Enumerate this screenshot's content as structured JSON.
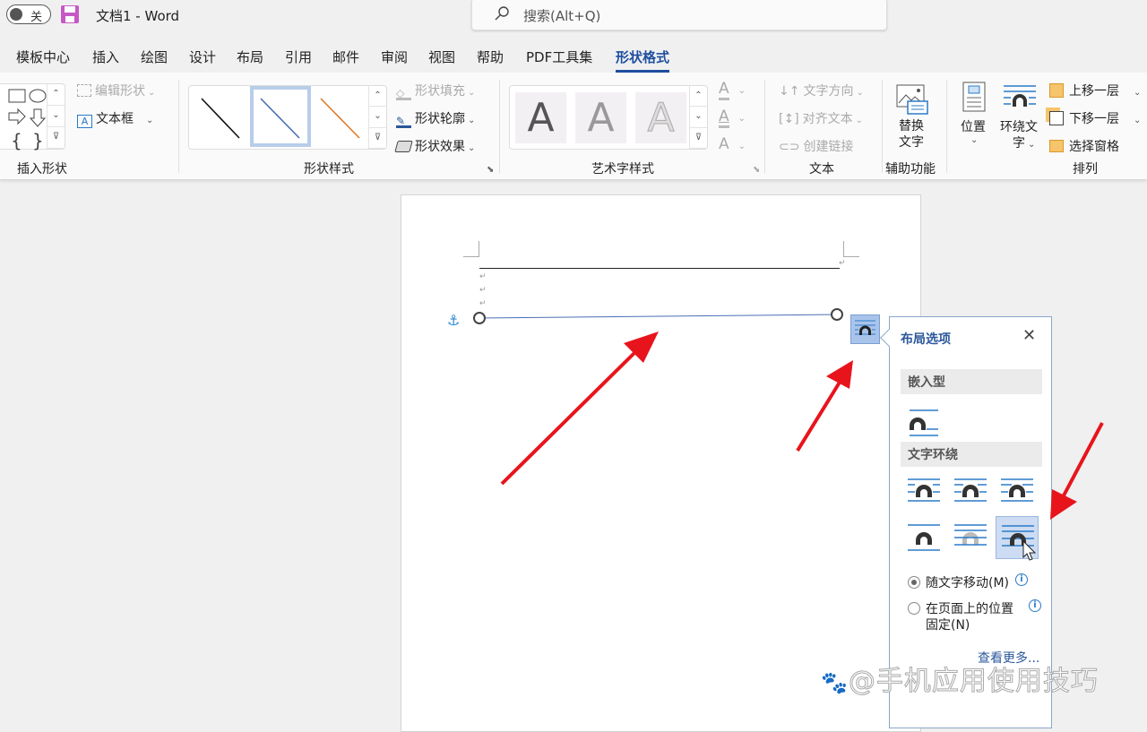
{
  "titlebar": {
    "autosave_label": "关",
    "doc_title": "文档1  -  Word",
    "search_placeholder": "搜索(Alt+Q)"
  },
  "tabs": [
    {
      "label": "模板中心"
    },
    {
      "label": "插入"
    },
    {
      "label": "绘图"
    },
    {
      "label": "设计"
    },
    {
      "label": "布局"
    },
    {
      "label": "引用"
    },
    {
      "label": "邮件"
    },
    {
      "label": "审阅"
    },
    {
      "label": "视图"
    },
    {
      "label": "帮助"
    },
    {
      "label": "PDF工具集"
    },
    {
      "label": "形状格式",
      "active": true
    }
  ],
  "ribbon": {
    "insert_shapes": {
      "label": "插入形状",
      "edit_shape": "编辑形状",
      "text_box": "文本框"
    },
    "shape_styles": {
      "label": "形状样式",
      "styles": [
        {
          "name": "black-line",
          "color": "#111111"
        },
        {
          "name": "blue-line",
          "color": "#4a6fb5",
          "selected": true
        },
        {
          "name": "orange-line",
          "color": "#e07b2a"
        }
      ],
      "fill": "形状填充",
      "outline": "形状轮廓",
      "effects": "形状效果"
    },
    "wordart": {
      "label": "艺术字样式",
      "samples": [
        "A",
        "A",
        "A"
      ]
    },
    "text": {
      "label": "文本",
      "direction": "文字方向",
      "align": "对齐文本",
      "link": "创建链接"
    },
    "accessibility": {
      "label": "辅助功能",
      "alt_text_line1": "替换",
      "alt_text_line2": "文字"
    },
    "arrange": {
      "label": "排列",
      "position": "位置",
      "wrap_line1": "环绕文",
      "wrap_line2": "字",
      "bring_forward": "上移一层",
      "send_backward": "下移一层",
      "selection_pane": "选择窗格"
    }
  },
  "layout_panel": {
    "title": "布局选项",
    "inline_section": "嵌入型",
    "wrap_section": "文字环绕",
    "selected_option": 6,
    "radio_move": "随文字移动(M)",
    "radio_fixed_line1": "在页面上的位置",
    "radio_fixed_line2": "固定(N)",
    "radio_selected": "move",
    "see_more": "查看更多..."
  },
  "watermark": "@手机应用使用技巧",
  "colors": {
    "accent": "#1e4e9e",
    "annotation_arrow": "#e8141c",
    "line_shape": "#4a6fb5"
  }
}
